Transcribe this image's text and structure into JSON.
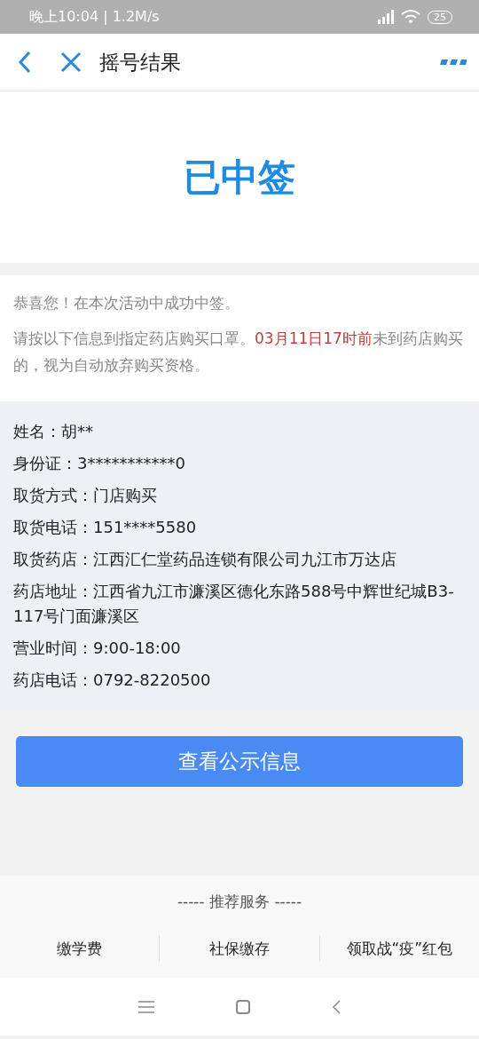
{
  "status_bar": {
    "time": "晚上10:04 | 1.2M/s",
    "battery": "25"
  },
  "header": {
    "title": "摇号结果"
  },
  "result": {
    "title": "已中签"
  },
  "notice": {
    "greeting": "恭喜您！在本次活动中成功中签。",
    "instruction": {
      "before": "请按以下信息到指定药店购买口罩。",
      "highlight": "03月11日17时前",
      "after": "未到药店购买的，视为自动放弃购买资格。"
    }
  },
  "info_rows": [
    "姓名：胡**",
    "身份证：3***********0",
    "取货方式：门店购买",
    "取货电话：151****5580",
    "取货药店：江西汇仁堂药品连锁有限公司九江市万达店",
    "药店地址：江西省九江市濂溪区德化东路588号中辉世纪城B3-117号门面濂溪区",
    "营业时间：9:00-18:00",
    "药店电话：0792-8220500"
  ],
  "action_button": "查看公示信息",
  "recommend": {
    "title": "----- 推荐服务 -----",
    "items": [
      "缴学费",
      "社保缴存",
      "领取战“疫”红包"
    ]
  }
}
